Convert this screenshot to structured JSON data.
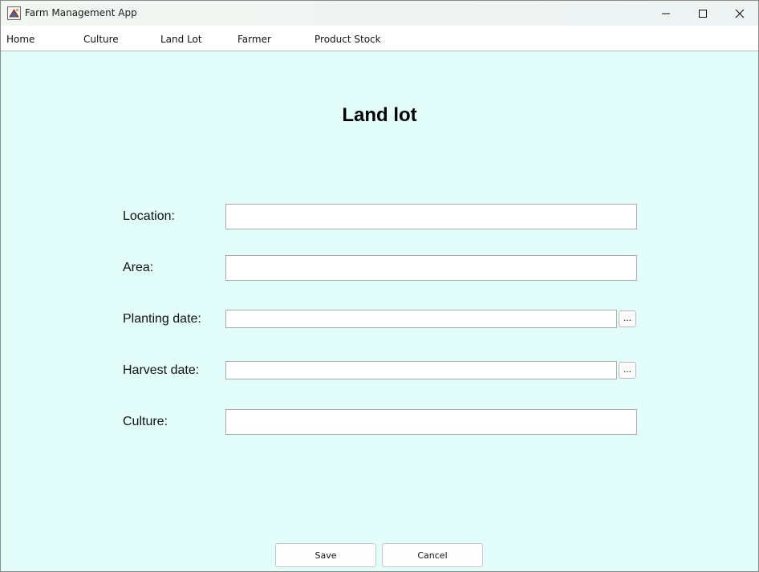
{
  "window": {
    "title": "Farm Management App",
    "background_color": "#e2fdfa"
  },
  "menu": {
    "items": [
      {
        "label": "Home"
      },
      {
        "label": "Culture"
      },
      {
        "label": "Land Lot"
      },
      {
        "label": "Farmer"
      },
      {
        "label": "Product Stock"
      }
    ]
  },
  "form": {
    "title": "Land lot",
    "location": {
      "label": "Location:",
      "value": ""
    },
    "area": {
      "label": "Area:",
      "value": ""
    },
    "planting_date": {
      "label": "Planting date:",
      "value": "",
      "picker_label": "..."
    },
    "harvest_date": {
      "label": "Harvest date:",
      "value": "",
      "picker_label": "..."
    },
    "culture": {
      "label": "Culture:",
      "value": ""
    }
  },
  "actions": {
    "save_label": "Save",
    "cancel_label": "Cancel"
  }
}
